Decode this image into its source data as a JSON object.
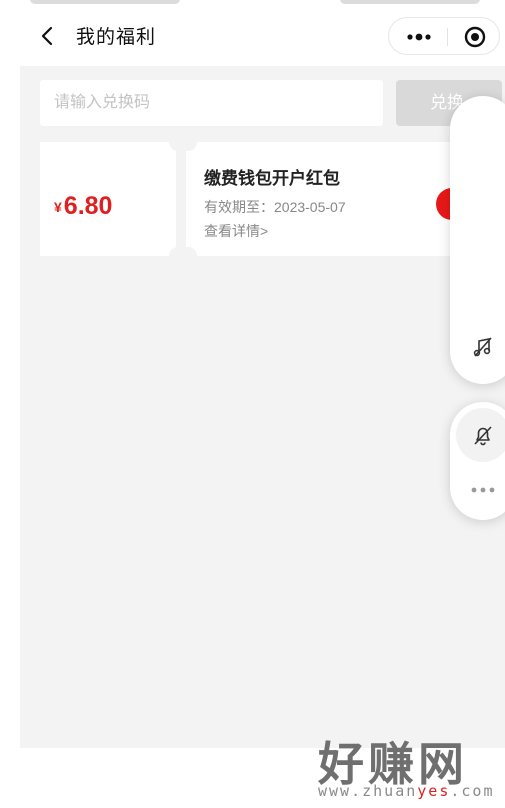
{
  "header": {
    "title": "我的福利",
    "back_icon": "chevron-left-icon",
    "more_icon": "more-dots-icon",
    "target_icon": "target-circle-icon"
  },
  "redeem": {
    "placeholder": "请输入兑换码",
    "button_label": "兑换"
  },
  "coupons": [
    {
      "currency": "¥",
      "amount": "6.80",
      "title": "缴费钱包开户红包",
      "expiry": "有效期至：2023-05-07",
      "detail_link": "查看详情>"
    }
  ],
  "float_panel": {
    "music_icon": "music-off-icon",
    "bell_icon": "bell-off-icon",
    "more_icon": "more-horizontal-icon"
  },
  "watermark": {
    "main": "好赚网",
    "url_prefix": "www.zhuan",
    "url_highlight": "yes",
    "url_suffix": ".com"
  },
  "colors": {
    "accent_red": "#e02020",
    "background_gray": "#f3f3f3",
    "disabled_button": "#d9d9d9"
  }
}
